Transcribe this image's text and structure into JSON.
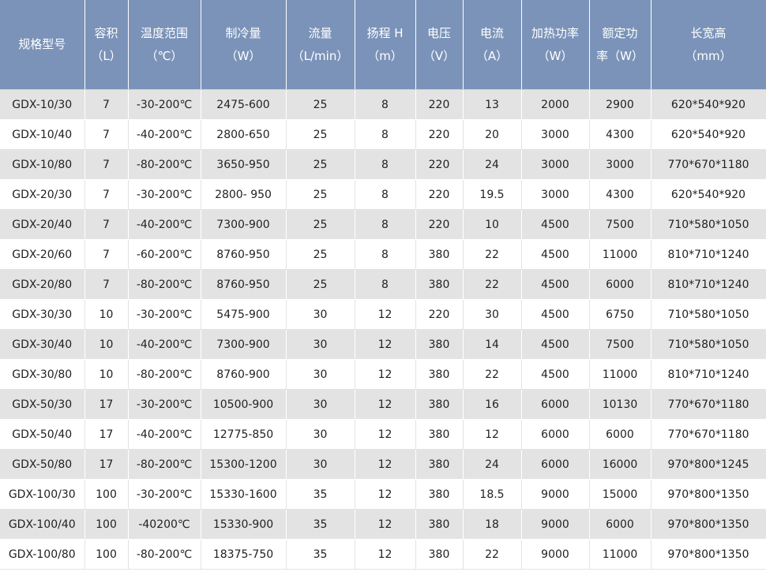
{
  "table": {
    "headers": [
      {
        "l1": "规格型号",
        "l2": ""
      },
      {
        "l1": "容积",
        "l2": "（L）"
      },
      {
        "l1": "温度范围",
        "l2": "（℃）"
      },
      {
        "l1": "制冷量",
        "l2": "（W）"
      },
      {
        "l1": "流量",
        "l2": "（L/min）"
      },
      {
        "l1": "扬程 H",
        "l2": "（m）"
      },
      {
        "l1": "电压",
        "l2": "（V）"
      },
      {
        "l1": "电流",
        "l2": "（A）"
      },
      {
        "l1": "加热功率",
        "l2": "（W）"
      },
      {
        "l1": "额定功",
        "l2": "率（W）"
      },
      {
        "l1": "长宽高",
        "l2": "（mm）"
      }
    ],
    "rows": [
      [
        "GDX-10/30",
        "7",
        "-30-200℃",
        "2475-600",
        "25",
        "8",
        "220",
        "13",
        "2000",
        "2900",
        "620*540*920"
      ],
      [
        "GDX-10/40",
        "7",
        "-40-200℃",
        "2800-650",
        "25",
        "8",
        "220",
        "20",
        "3000",
        "4300",
        "620*540*920"
      ],
      [
        "GDX-10/80",
        "7",
        "-80-200℃",
        "3650-950",
        "25",
        "8",
        "220",
        "24",
        "3000",
        "3000",
        "770*670*1180"
      ],
      [
        "GDX-20/30",
        "7",
        "-30-200℃",
        "2800-  950",
        "25",
        "8",
        "220",
        "19.5",
        "3000",
        "4300",
        "620*540*920"
      ],
      [
        "GDX-20/40",
        "7",
        "-40-200℃",
        "7300-900",
        "25",
        "8",
        "220",
        "10",
        "4500",
        "7500",
        "710*580*1050"
      ],
      [
        "GDX-20/60",
        "7",
        "-60-200℃",
        "8760-950",
        "25",
        "8",
        "380",
        "22",
        "4500",
        "11000",
        "810*710*1240"
      ],
      [
        "GDX-20/80",
        "7",
        "-80-200℃",
        "8760-950",
        "25",
        "8",
        "380",
        "22",
        "4500",
        "6000",
        "810*710*1240"
      ],
      [
        "GDX-30/30",
        "10",
        "-30-200℃",
        "5475-900",
        "30",
        "12",
        "220",
        "30",
        "4500",
        "6750",
        "710*580*1050"
      ],
      [
        "GDX-30/40",
        "10",
        "-40-200℃",
        "7300-900",
        "30",
        "12",
        "380",
        "14",
        "4500",
        "7500",
        "710*580*1050"
      ],
      [
        "GDX-30/80",
        "10",
        "-80-200℃",
        "8760-900",
        "30",
        "12",
        "380",
        "22",
        "4500",
        "11000",
        "810*710*1240"
      ],
      [
        "GDX-50/30",
        "17",
        "-30-200℃",
        "10500-900",
        "30",
        "12",
        "380",
        "16",
        "6000",
        "10130",
        "770*670*1180"
      ],
      [
        "GDX-50/40",
        "17",
        "-40-200℃",
        "12775-850",
        "30",
        "12",
        "380",
        "12",
        "6000",
        "6000",
        "770*670*1180"
      ],
      [
        "GDX-50/80",
        "17",
        "-80-200℃",
        "15300-1200",
        "30",
        "12",
        "380",
        "24",
        "6000",
        "16000",
        "970*800*1245"
      ],
      [
        "GDX-100/30",
        "100",
        "-30-200℃",
        "15330-1600",
        "35",
        "12",
        "380",
        "18.5",
        "9000",
        "15000",
        "970*800*1350"
      ],
      [
        "GDX-100/40",
        "100",
        "-40200℃",
        "15330-900",
        "35",
        "12",
        "380",
        "18",
        "9000",
        "6000",
        "970*800*1350"
      ],
      [
        "GDX-100/80",
        "100",
        "-80-200℃",
        "18375-750",
        "35",
        "12",
        "380",
        "22",
        "9000",
        "11000",
        "970*800*1350"
      ]
    ]
  }
}
